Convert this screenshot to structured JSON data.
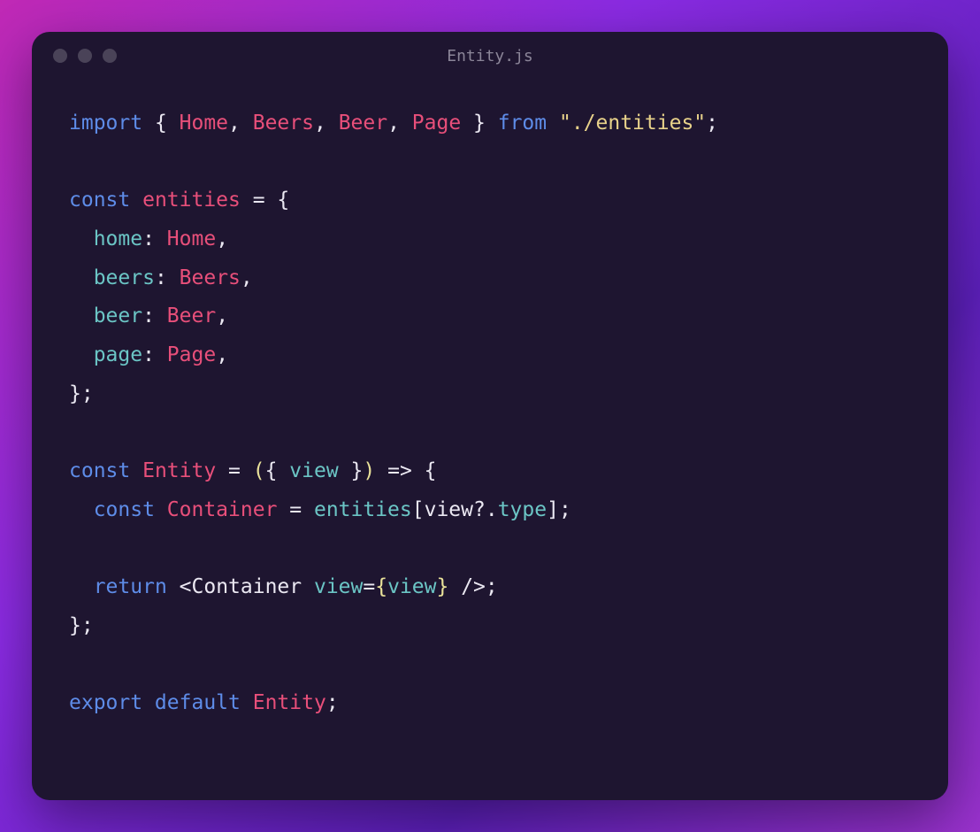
{
  "window": {
    "title": "Entity.js"
  },
  "code": {
    "tokens": [
      [
        {
          "t": "import ",
          "c": "tk-keyword"
        },
        {
          "t": "{ ",
          "c": "tk-punct"
        },
        {
          "t": "Home",
          "c": "tk-ident"
        },
        {
          "t": ", ",
          "c": "tk-punct"
        },
        {
          "t": "Beers",
          "c": "tk-ident"
        },
        {
          "t": ", ",
          "c": "tk-punct"
        },
        {
          "t": "Beer",
          "c": "tk-ident"
        },
        {
          "t": ", ",
          "c": "tk-punct"
        },
        {
          "t": "Page",
          "c": "tk-ident"
        },
        {
          "t": " } ",
          "c": "tk-punct"
        },
        {
          "t": "from ",
          "c": "tk-keyword"
        },
        {
          "t": "\"./entities\"",
          "c": "tk-string"
        },
        {
          "t": ";",
          "c": "tk-punct"
        }
      ],
      [],
      [
        {
          "t": "const ",
          "c": "tk-keyword"
        },
        {
          "t": "entities",
          "c": "tk-ident"
        },
        {
          "t": " = {",
          "c": "tk-punct"
        }
      ],
      [
        {
          "t": "  ",
          "c": ""
        },
        {
          "t": "home",
          "c": "tk-prop"
        },
        {
          "t": ": ",
          "c": "tk-punct"
        },
        {
          "t": "Home",
          "c": "tk-ident"
        },
        {
          "t": ",",
          "c": "tk-punct"
        }
      ],
      [
        {
          "t": "  ",
          "c": ""
        },
        {
          "t": "beers",
          "c": "tk-prop"
        },
        {
          "t": ": ",
          "c": "tk-punct"
        },
        {
          "t": "Beers",
          "c": "tk-ident"
        },
        {
          "t": ",",
          "c": "tk-punct"
        }
      ],
      [
        {
          "t": "  ",
          "c": ""
        },
        {
          "t": "beer",
          "c": "tk-prop"
        },
        {
          "t": ": ",
          "c": "tk-punct"
        },
        {
          "t": "Beer",
          "c": "tk-ident"
        },
        {
          "t": ",",
          "c": "tk-punct"
        }
      ],
      [
        {
          "t": "  ",
          "c": ""
        },
        {
          "t": "page",
          "c": "tk-prop"
        },
        {
          "t": ": ",
          "c": "tk-punct"
        },
        {
          "t": "Page",
          "c": "tk-ident"
        },
        {
          "t": ",",
          "c": "tk-punct"
        }
      ],
      [
        {
          "t": "};",
          "c": "tk-punct"
        }
      ],
      [],
      [
        {
          "t": "const ",
          "c": "tk-keyword"
        },
        {
          "t": "Entity",
          "c": "tk-ident"
        },
        {
          "t": " = ",
          "c": "tk-punct"
        },
        {
          "t": "(",
          "c": "tk-paren"
        },
        {
          "t": "{ ",
          "c": "tk-punct"
        },
        {
          "t": "view",
          "c": "tk-prop"
        },
        {
          "t": " }",
          "c": "tk-punct"
        },
        {
          "t": ")",
          "c": "tk-paren"
        },
        {
          "t": " => ",
          "c": "tk-punct"
        },
        {
          "t": "{",
          "c": "tk-punct"
        }
      ],
      [
        {
          "t": "  ",
          "c": ""
        },
        {
          "t": "const ",
          "c": "tk-keyword"
        },
        {
          "t": "Container",
          "c": "tk-ident"
        },
        {
          "t": " = ",
          "c": "tk-punct"
        },
        {
          "t": "entities",
          "c": "tk-prop"
        },
        {
          "t": "[",
          "c": "tk-punct"
        },
        {
          "t": "view",
          "c": "tk-var"
        },
        {
          "t": "?.",
          "c": "tk-punct"
        },
        {
          "t": "type",
          "c": "tk-prop"
        },
        {
          "t": "];",
          "c": "tk-punct"
        }
      ],
      [],
      [
        {
          "t": "  ",
          "c": ""
        },
        {
          "t": "return ",
          "c": "tk-keyword"
        },
        {
          "t": "<",
          "c": "tk-punct"
        },
        {
          "t": "Container ",
          "c": "tk-var"
        },
        {
          "t": "view",
          "c": "tk-prop"
        },
        {
          "t": "=",
          "c": "tk-punct"
        },
        {
          "t": "{",
          "c": "tk-paren"
        },
        {
          "t": "view",
          "c": "tk-prop"
        },
        {
          "t": "}",
          "c": "tk-paren"
        },
        {
          "t": " />;",
          "c": "tk-punct"
        }
      ],
      [
        {
          "t": "};",
          "c": "tk-punct"
        }
      ],
      [],
      [
        {
          "t": "export default ",
          "c": "tk-keyword"
        },
        {
          "t": "Entity",
          "c": "tk-ident"
        },
        {
          "t": ";",
          "c": "tk-punct"
        }
      ]
    ]
  }
}
